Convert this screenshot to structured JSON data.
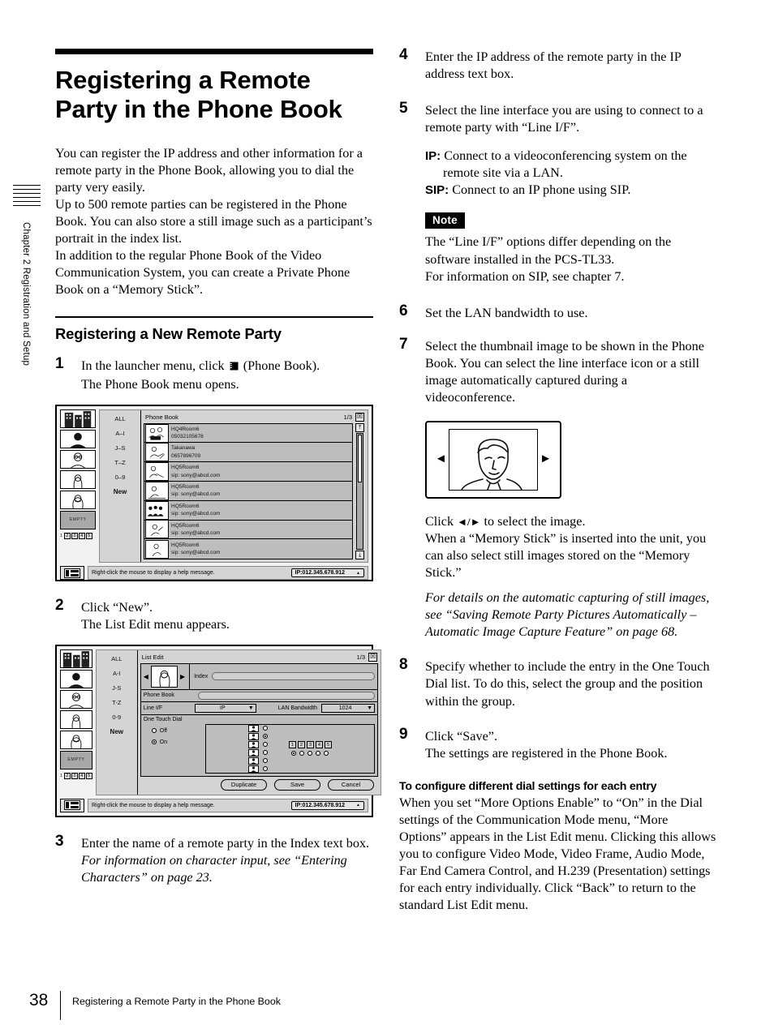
{
  "chapter_tab": {
    "label": "Chapter 2  Registration and Setup"
  },
  "heading": {
    "title": "Registering a Remote Party in the Phone Book",
    "intro_p1": "You can register the IP address and other information for a remote party in the Phone Book, allowing you to dial the party very easily.",
    "intro_p2": "Up to 500 remote parties can be registered in the Phone Book. You can also store a still image such as a participant’s portrait in the index list.",
    "intro_p3": "In addition to the regular Phone Book of the Video Communication System, you can create a Private Phone Book on a “Memory Stick”.",
    "subtitle": "Registering a New Remote Party"
  },
  "steps": {
    "s1": {
      "num": "1",
      "text_before": "In the launcher menu, click",
      "icon": "phone-book-icon",
      "text_after": "(Phone Book).",
      "result": "The Phone Book menu opens."
    },
    "s2": {
      "num": "2",
      "text": "Click “New”.",
      "result": "The List Edit menu appears."
    },
    "s3": {
      "num": "3",
      "text": "Enter the name of a remote party in the Index text box.",
      "note_italic": "For information on character input, see “Entering Characters” on page 23."
    },
    "s4": {
      "num": "4",
      "text": "Enter the IP address of the remote party in the IP address text box."
    },
    "s5": {
      "num": "5",
      "text": "Select the line interface you are using to connect to a remote party with “Line I/F”.",
      "def_ip_term": "IP:",
      "def_ip_desc": "Connect to a videoconferencing system on the remote site via a LAN.",
      "def_sip_term": "SIP:",
      "def_sip_desc": "Connect to an IP phone using SIP.",
      "note_badge": "Note",
      "note_line1": "The “Line I/F” options differ depending on the software installed in the PCS-TL33.",
      "note_line2": "For information on SIP, see chapter 7."
    },
    "s6": {
      "num": "6",
      "text": "Set the LAN bandwidth to use."
    },
    "s7": {
      "num": "7",
      "text": "Select the thumbnail image to be shown in the Phone Book. You can select the line interface icon or a still image automatically captured during a videoconference.",
      "after_line1_a": "Click",
      "after_line1_arrows": "◄/►",
      "after_line1_b": "to select the image.",
      "after_line2": "When a “Memory Stick” is inserted into the unit, you can also select still images stored on the “Memory Stick.”",
      "note_italic": "For details on the automatic capturing of still images, see “Saving Remote Party Pictures Automatically – Automatic Image Capture Feature” on page 68."
    },
    "s8": {
      "num": "8",
      "text": "Specify whether to include the entry in the One Touch Dial list. To do this, select the group and the position within the group."
    },
    "s9": {
      "num": "9",
      "text": "Click “Save”.",
      "result": "The settings are registered in the Phone Book."
    }
  },
  "closing": {
    "runhead": "To configure different dial settings for each entry",
    "body": "When you set “More Options Enable” to “On” in the Dial settings of the Communication Mode menu, “More Options” appears in the List Edit menu. Clicking this allows you to configure Video Mode, Video Frame, Audio Mode, Far End Camera Control, and H.239 (Presentation) settings for each entry individually. Click “Back” to return to the standard List Edit menu."
  },
  "phonebook_shot": {
    "sidebar": {
      "tiles": [
        "building-thumb",
        "silhouette-thumb",
        "man-glasses-thumb",
        "woman-thumb",
        "woman2-thumb"
      ],
      "empty_label": "EMPTY",
      "num_buttons": [
        "1",
        "2",
        "3",
        "4",
        "5"
      ]
    },
    "nav": [
      "ALL",
      "A–I",
      "J–S",
      "T–Z",
      "0–9"
    ],
    "nav_new": "New",
    "panel_title": "Phone Book",
    "page_indicator": "1/3",
    "close_glyph": "☒",
    "scroll_up_glyph": "⤒",
    "scroll_down_glyph": "⤓",
    "entries": [
      {
        "name": "HQ4Room6",
        "detail": "05032105678",
        "thumb": "group-thumb"
      },
      {
        "name": "Takanawa",
        "detail": "0657896709",
        "thumb": "person-desk-thumb"
      },
      {
        "name": "HQ5Room6",
        "detail": "sip: sony@abcd.com",
        "thumb": "person-pointing-thumb"
      },
      {
        "name": "HQ5Room6",
        "detail": "sip: sony@abcd.com",
        "thumb": "person-sitting-thumb"
      },
      {
        "name": "HQ5Room6",
        "detail": "sip: sony@abcd.com",
        "thumb": "meeting-thumb"
      },
      {
        "name": "HQ5Room6",
        "detail": "sip: sony@abcd.com",
        "thumb": "person-waving-thumb"
      },
      {
        "name": "HQ5Room6",
        "detail": "sip: sony@abcd.com",
        "thumb": "person-standing-thumb"
      }
    ],
    "status_message": "Right-click the mouse to display a help message.",
    "ip_badge": "IP:012.345.678.912",
    "ip_badge_arrow": "▲"
  },
  "listedit_shot": {
    "nav": [
      "ALL",
      "A-I",
      "J-S",
      "T-Z",
      "0-9"
    ],
    "nav_new": "New",
    "panel_title": "List Edit",
    "page_indicator": "1/3",
    "close_glyph": "☒",
    "index_label": "Index",
    "index_value": "",
    "phonebook_label": "Phone Book",
    "phonebook_value": "",
    "lineif_label": "Line I/F",
    "lineif_value": "IP",
    "bandwidth_label": "LAN Bandwidth",
    "bandwidth_value": "1024",
    "otd_label": "One Touch Dial",
    "otd_off": "Off",
    "otd_on": "On",
    "group_numbers": [
      "1",
      "2",
      "3",
      "4",
      "5"
    ],
    "buttons": [
      "Duplicate",
      "Save",
      "Cancel"
    ],
    "status_message": "Right-click the mouse to display a help message.",
    "ip_badge": "IP:012.345.678.912",
    "ip_badge_arrow": "▲"
  },
  "image_selector": {
    "left_arrow": "◄",
    "right_arrow": "►",
    "image": "portrait-man-illustration"
  },
  "footer": {
    "page_number": "38",
    "text": "Registering a Remote Party in the Phone Book"
  }
}
